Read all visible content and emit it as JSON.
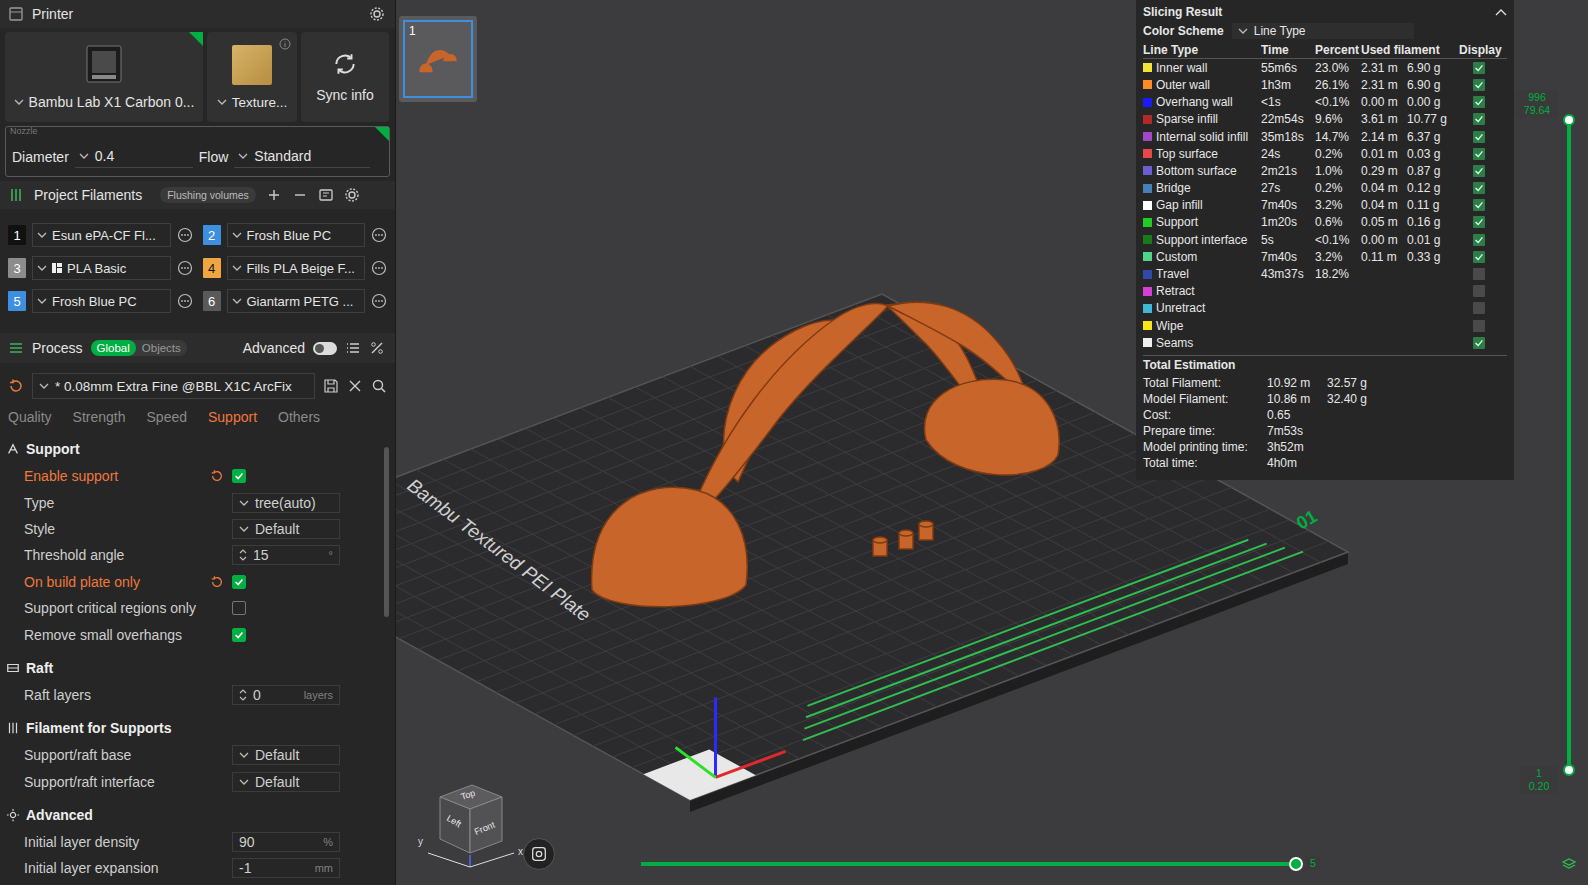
{
  "printer": {
    "title": "Printer",
    "device": "Bambu Lab X1 Carbon 0...",
    "plate": "Texture...",
    "sync": "Sync info",
    "nozzle_legend": "Nozzle",
    "diameter_label": "Diameter",
    "diameter": "0.4",
    "flow_label": "Flow",
    "flow": "Standard"
  },
  "filaments": {
    "title": "Project Filaments",
    "badge": "Flushing volumes",
    "items": [
      {
        "index": "1",
        "name": "Esun ePA-CF Fl...",
        "color": "#111111",
        "brand": false
      },
      {
        "index": "2",
        "name": "Frosh Blue PC",
        "color": "#3f8fe0",
        "brand": false
      },
      {
        "index": "3",
        "name": "PLA Basic",
        "color": "#8c8c8c",
        "brand": true
      },
      {
        "index": "4",
        "name": "Fills PLA Beige F...",
        "color": "#f0a640",
        "brand": false
      },
      {
        "index": "5",
        "name": "Frosh Blue PC",
        "color": "#3f8fe0",
        "brand": false
      },
      {
        "index": "6",
        "name": "Giantarm PETG ...",
        "color": "#5a5a5a",
        "brand": false
      }
    ]
  },
  "process": {
    "title": "Process",
    "scopes": [
      {
        "label": "Global",
        "selected": true
      },
      {
        "label": "Objects",
        "selected": false
      }
    ],
    "advanced": {
      "label": "Advanced",
      "on": false
    },
    "preset": "* 0.08mm Extra Fine @BBL X1C ArcFix",
    "preset_modified": true,
    "tabs": [
      {
        "label": "Quality",
        "selected": false
      },
      {
        "label": "Strength",
        "selected": false
      },
      {
        "label": "Speed",
        "selected": false
      },
      {
        "label": "Support",
        "selected": true
      },
      {
        "label": "Others",
        "selected": false
      }
    ]
  },
  "settings": [
    {
      "title": "Support",
      "rows": [
        {
          "label": "Enable support",
          "kind": "checkbox",
          "modified": true,
          "checked": true
        },
        {
          "label": "Type",
          "kind": "select",
          "modified": false,
          "value": "tree(auto)"
        },
        {
          "label": "Style",
          "kind": "select",
          "modified": false,
          "value": "Default"
        },
        {
          "label": "Threshold angle",
          "kind": "spin",
          "modified": false,
          "value": "15",
          "unit": "°"
        },
        {
          "label": "On build plate only",
          "kind": "checkbox",
          "modified": true,
          "checked": true
        },
        {
          "label": "Support critical regions only",
          "kind": "checkbox",
          "modified": false,
          "checked": false
        },
        {
          "label": "Remove small overhangs",
          "kind": "checkbox",
          "modified": false,
          "checked": true
        }
      ]
    },
    {
      "title": "Raft",
      "rows": [
        {
          "label": "Raft layers",
          "kind": "spin",
          "modified": false,
          "value": "0",
          "unit": "layers"
        }
      ]
    },
    {
      "title": "Filament for Supports",
      "rows": [
        {
          "label": "Support/raft base",
          "kind": "select",
          "modified": false,
          "value": "Default"
        },
        {
          "label": "Support/raft interface",
          "kind": "select",
          "modified": false,
          "value": "Default"
        }
      ]
    },
    {
      "title": "Advanced",
      "rows": [
        {
          "label": "Initial layer density",
          "kind": "number",
          "modified": false,
          "value": "90",
          "unit": "%"
        },
        {
          "label": "Initial layer expansion",
          "kind": "number",
          "modified": false,
          "value": "-1",
          "unit": "mm"
        }
      ]
    }
  ],
  "viewport": {
    "plate_thumb": "1",
    "bed_label": "Bambu Textured PEI Plate",
    "plate_number": "01",
    "layer_slider": {
      "top": [
        "996",
        "79.64"
      ],
      "bottom": [
        "1",
        "0.20"
      ],
      "level": 1
    },
    "move_slider": {
      "label": "5",
      "level": 1
    },
    "view_cube": {
      "top": "Top",
      "left": "Left",
      "front": "Front"
    },
    "axes": {
      "x": "x",
      "y": "y"
    }
  },
  "slicing_result": {
    "title": "Slicing Result",
    "scheme_label": "Color Scheme",
    "scheme": "Line Type",
    "columns": [
      "Line Type",
      "Time",
      "Percent",
      "Used filament",
      "Display"
    ],
    "rows": [
      {
        "name": "Inner wall",
        "color": "#f2e23a",
        "time": "55m6s",
        "percent": "23.0%",
        "meters": "2.31 m",
        "grams": "6.90 g",
        "display": true
      },
      {
        "name": "Outer wall",
        "color": "#ff8a2a",
        "time": "1h3m",
        "percent": "26.1%",
        "meters": "2.31 m",
        "grams": "6.90 g",
        "display": true
      },
      {
        "name": "Overhang wall",
        "color": "#1a1aff",
        "time": "<1s",
        "percent": "<0.1%",
        "meters": "0.00 m",
        "grams": "0.00 g",
        "display": true
      },
      {
        "name": "Sparse infill",
        "color": "#b02a2a",
        "time": "22m54s",
        "percent": "9.6%",
        "meters": "3.61 m",
        "grams": "10.77 g",
        "display": true
      },
      {
        "name": "Internal solid infill",
        "color": "#a347c4",
        "time": "35m18s",
        "percent": "14.7%",
        "meters": "2.14 m",
        "grams": "6.37 g",
        "display": true
      },
      {
        "name": "Top surface",
        "color": "#e84848",
        "time": "24s",
        "percent": "0.2%",
        "meters": "0.01 m",
        "grams": "0.03 g",
        "display": true
      },
      {
        "name": "Bottom surface",
        "color": "#6b5fcf",
        "time": "2m21s",
        "percent": "1.0%",
        "meters": "0.29 m",
        "grams": "0.87 g",
        "display": true
      },
      {
        "name": "Bridge",
        "color": "#4a7fb5",
        "time": "27s",
        "percent": "0.2%",
        "meters": "0.04 m",
        "grams": "0.12 g",
        "display": true
      },
      {
        "name": "Gap infill",
        "color": "#ffffff",
        "time": "7m40s",
        "percent": "3.2%",
        "meters": "0.04 m",
        "grams": "0.11 g",
        "display": true
      },
      {
        "name": "Support",
        "color": "#22cc22",
        "time": "1m20s",
        "percent": "0.6%",
        "meters": "0.05 m",
        "grams": "0.16 g",
        "display": true
      },
      {
        "name": "Support interface",
        "color": "#1a7a1a",
        "time": "5s",
        "percent": "<0.1%",
        "meters": "0.00 m",
        "grams": "0.01 g",
        "display": true
      },
      {
        "name": "Custom",
        "color": "#4fd48a",
        "time": "7m40s",
        "percent": "3.2%",
        "meters": "0.11 m",
        "grams": "0.33 g",
        "display": true
      },
      {
        "name": "Travel",
        "color": "#2f4aa8",
        "time": "43m37s",
        "percent": "18.2%",
        "meters": "",
        "grams": "",
        "display": false
      },
      {
        "name": "Retract",
        "color": "#d63fd6",
        "time": "",
        "percent": "",
        "meters": "",
        "grams": "",
        "display": false
      },
      {
        "name": "Unretract",
        "color": "#3fb8d6",
        "time": "",
        "percent": "",
        "meters": "",
        "grams": "",
        "display": false
      },
      {
        "name": "Wipe",
        "color": "#f5e61a",
        "time": "",
        "percent": "",
        "meters": "",
        "grams": "",
        "display": false
      },
      {
        "name": "Seams",
        "color": "#eeeeee",
        "time": "",
        "percent": "",
        "meters": "",
        "grams": "",
        "display": true
      }
    ],
    "totals_title": "Total Estimation",
    "totals": [
      {
        "label": "Total Filament:",
        "values": [
          "10.92 m",
          "32.57 g"
        ]
      },
      {
        "label": "Model Filament:",
        "values": [
          "10.86 m",
          "32.40 g"
        ]
      },
      {
        "label": "Cost:",
        "values": [
          "0.65"
        ]
      },
      {
        "label": "Prepare time:",
        "values": [
          "7m53s"
        ]
      },
      {
        "label": "Model printing time:",
        "values": [
          "3h52m"
        ]
      },
      {
        "label": "Total time:",
        "values": [
          "4h0m"
        ]
      }
    ]
  }
}
